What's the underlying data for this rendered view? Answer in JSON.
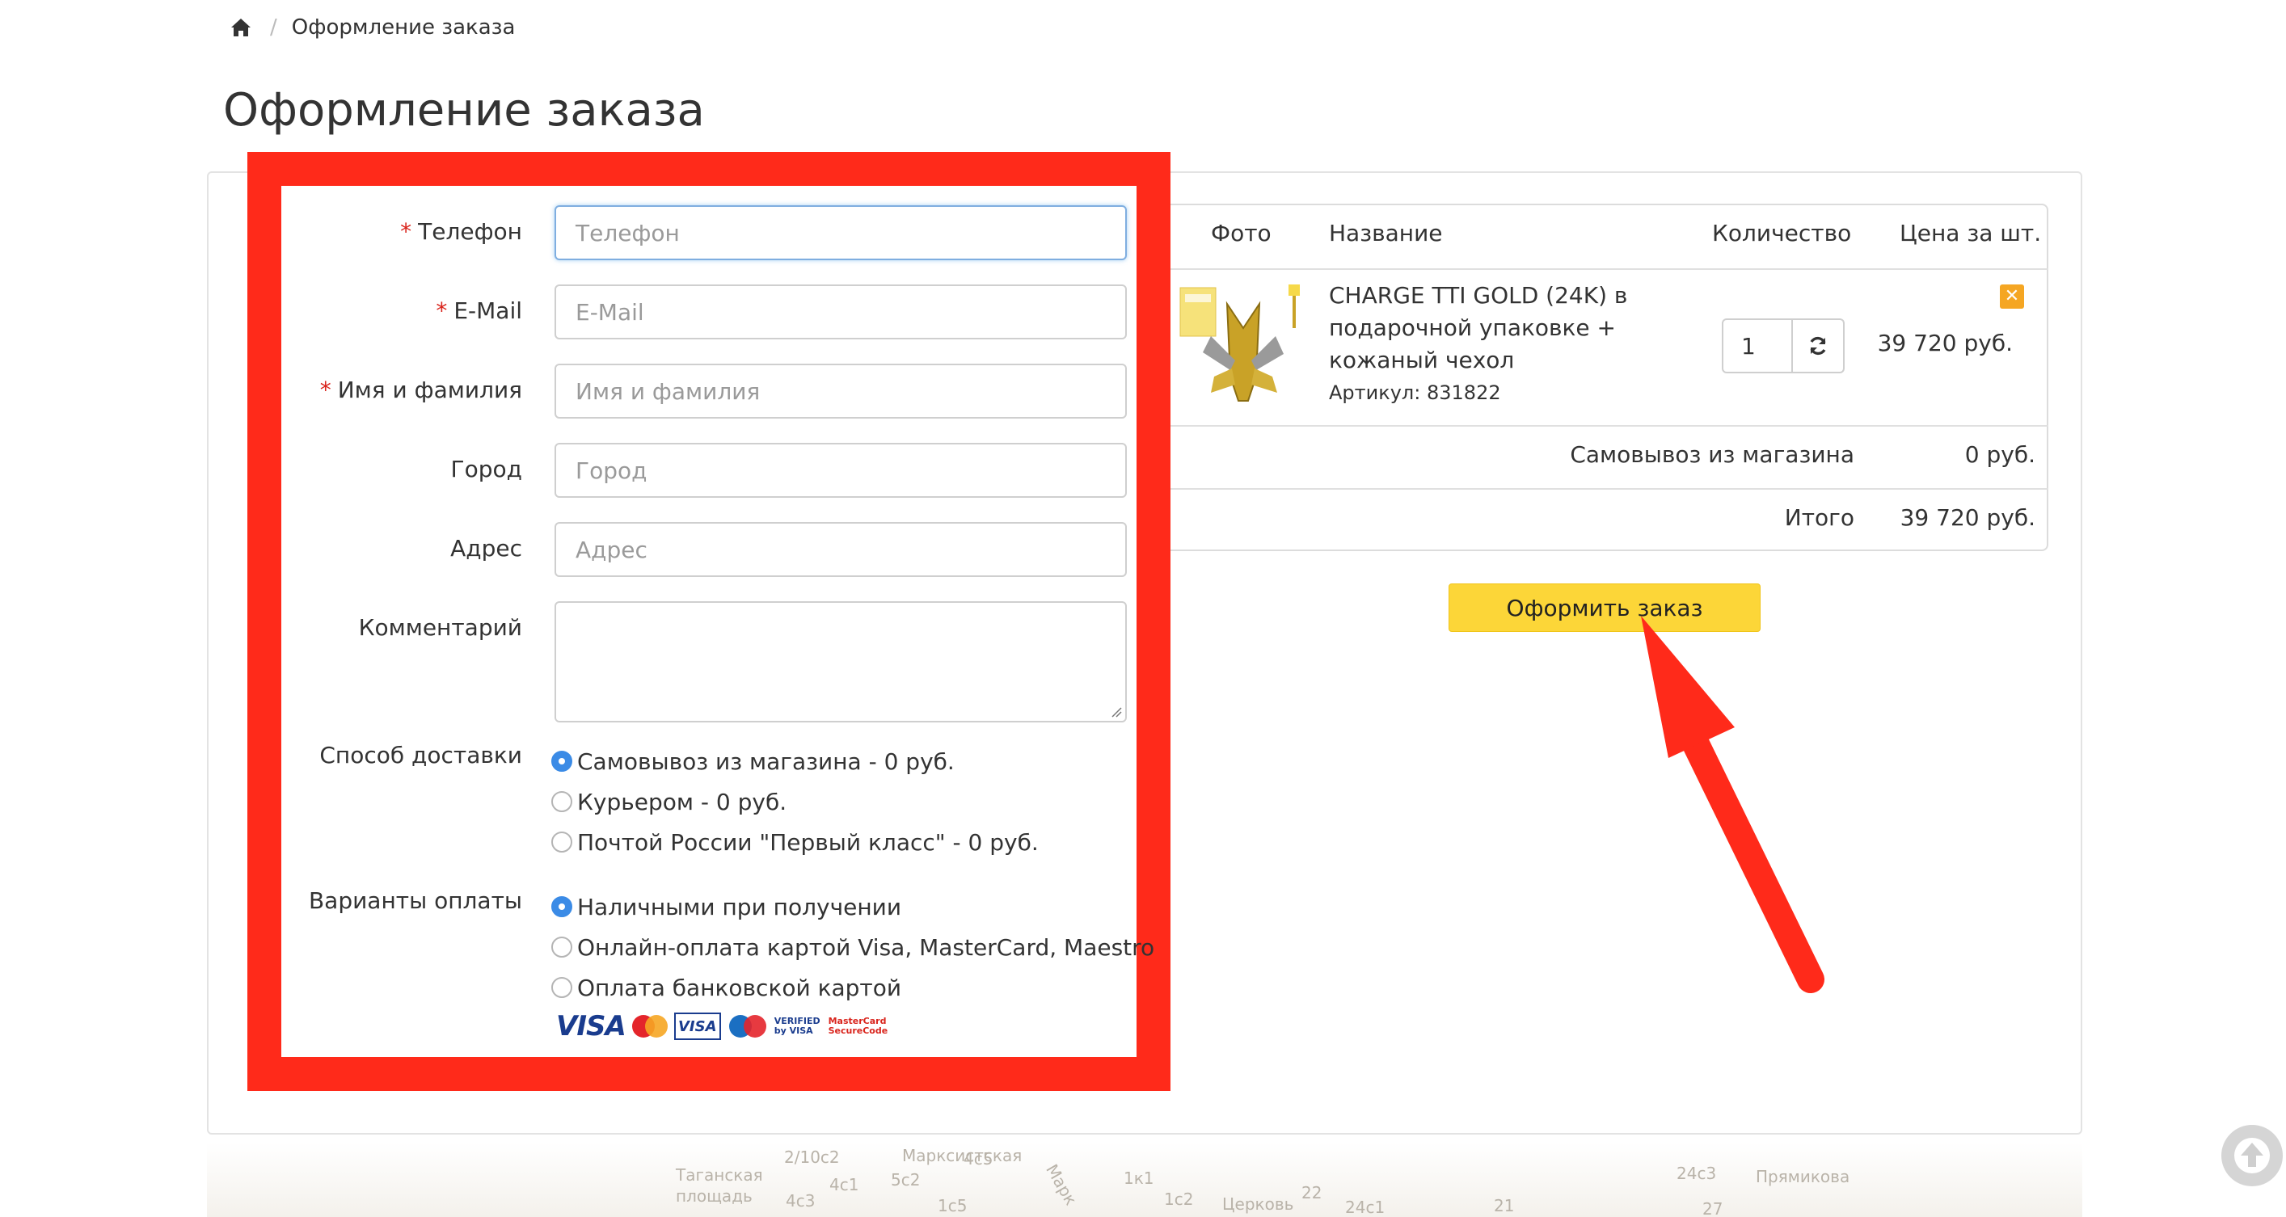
{
  "breadcrumb": {
    "current": "Оформление заказа",
    "separator": "/"
  },
  "page_title": "Оформление заказа",
  "form": {
    "fields": [
      {
        "label": "Телефон",
        "required": true,
        "placeholder": "Телефон"
      },
      {
        "label": "E-Mail",
        "required": true,
        "placeholder": "E-Mail"
      },
      {
        "label": "Имя и фамилия",
        "required": true,
        "placeholder": "Имя и фамилия"
      },
      {
        "label": "Город",
        "required": false,
        "placeholder": "Город"
      },
      {
        "label": "Адрес",
        "required": false,
        "placeholder": "Адрес"
      }
    ],
    "required_mark": "*",
    "comment_label": "Комментарий",
    "delivery": {
      "label": "Способ доставки",
      "options": [
        {
          "text": "Самовывоз из магазина - 0 руб.",
          "checked": true
        },
        {
          "text": "Курьером - 0 руб.",
          "checked": false
        },
        {
          "text": "Почтой России \"Первый класс\" - 0 руб.",
          "checked": false
        }
      ]
    },
    "payment": {
      "label": "Варианты оплаты",
      "options": [
        {
          "text": "Наличными при получении",
          "checked": true
        },
        {
          "text": "Онлайн-оплата картой Visa, MasterCard, Maestro",
          "checked": false
        },
        {
          "text": "Оплата банковской картой",
          "checked": false
        }
      ],
      "card_logos": {
        "visa": "VISA",
        "visa_small": "VISA",
        "verified_1": "VERIFIED",
        "verified_2": "by VISA",
        "securecode_1": "MasterCard",
        "securecode_2": "SecureCode"
      }
    }
  },
  "cart": {
    "headers": {
      "photo": "Фото",
      "name": "Название",
      "quantity": "Количество",
      "price": "Цена за шт."
    },
    "items": [
      {
        "name": "CHARGE TTI GOLD (24K) в подарочной упаковке + кожаный чехол",
        "sku": "Артикул: 831822",
        "quantity": "1",
        "price": "39 720 руб."
      }
    ],
    "shipping_label": "Самовывоз из магазина",
    "shipping_value": "0 руб.",
    "total_label": "Итого",
    "total_value": "39 720 руб."
  },
  "order_button": "Оформить заказ",
  "map_labels": [
    "Таганская",
    "площадь",
    "Марксистская",
    "Церковь",
    "Прямикова",
    "Марк",
    "2/10с2",
    "5с2",
    "4с3",
    "4с1",
    "1к1",
    "1с5",
    "1с2",
    "22",
    "24с1",
    "21",
    "24с3",
    "27",
    "4с5"
  ],
  "colors": {
    "accent_red": "#ff2a1a",
    "button_yellow": "#fcd638",
    "radio_blue": "#3b8be6",
    "remove_orange": "#f5a623"
  }
}
